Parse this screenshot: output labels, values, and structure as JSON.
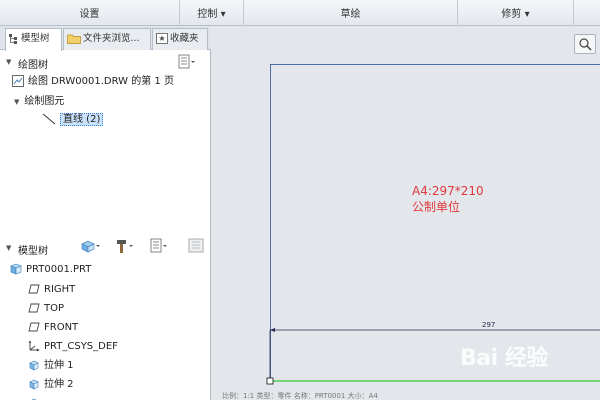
{
  "ribbon": {
    "groups": [
      {
        "label": "设置"
      },
      {
        "label": "控制 ▾"
      },
      {
        "label": "草绘"
      },
      {
        "label": "修剪 ▾"
      }
    ]
  },
  "tabs": {
    "model_tree": "模型树",
    "folder_browser": "文件夹浏览...",
    "favorites": "收藏夹"
  },
  "drawing_tree": {
    "header": "绘图树",
    "sheet_item": "绘图 DRW0001.DRW 的第 1 页",
    "draw_items_folder": "绘制图元",
    "line_item": "直线 (2)"
  },
  "model_tree": {
    "header": "模型树",
    "part": "PRT0001.PRT",
    "items": [
      {
        "label": "RIGHT",
        "icon": "datum-plane-icon"
      },
      {
        "label": "TOP",
        "icon": "datum-plane-icon"
      },
      {
        "label": "FRONT",
        "icon": "datum-plane-icon"
      },
      {
        "label": "PRT_CSYS_DEF",
        "icon": "coordinate-system-icon"
      },
      {
        "label": "拉伸 1",
        "icon": "extrude-icon"
      },
      {
        "label": "拉伸 2",
        "icon": "extrude-icon"
      }
    ]
  },
  "canvas": {
    "note_line1": "A4:297*210",
    "note_line2": "公制单位",
    "dimension": "297",
    "status": "比例：1:1  类型：零件  名称：PRT0001  大小：A4"
  },
  "watermark": {
    "text": "Bai 经验"
  },
  "colors": {
    "note_red": "#e0393e",
    "sheet_border": "#4f6ea8",
    "green_line": "#33cc33",
    "selection_bg": "#c9e1fb"
  }
}
